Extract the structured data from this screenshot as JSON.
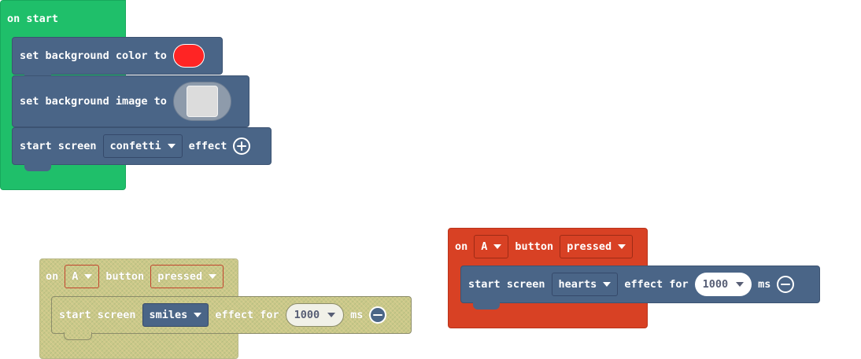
{
  "on_start": {
    "hat_label": "on start",
    "blocks": {
      "bg_color": {
        "label": "set background color to",
        "color_value": "#ff2424"
      },
      "bg_image": {
        "label": "set background image to"
      },
      "effect": {
        "label_pre": "start screen",
        "dropdown": "confetti",
        "label_post": "effect",
        "expand_icon": "plus-circle-icon"
      }
    }
  },
  "event_disabled": {
    "on": "on",
    "button": "A",
    "button_label": "button",
    "state": "pressed",
    "inner": {
      "label_pre": "start screen",
      "effect": "smiles",
      "label_mid": "effect for",
      "duration": "1000",
      "unit": "ms",
      "collapse_icon": "minus-circle-icon"
    }
  },
  "event_active": {
    "on": "on",
    "button": "A",
    "button_label": "button",
    "state": "pressed",
    "inner": {
      "label_pre": "start screen",
      "effect": "hearts",
      "label_mid": "effect for",
      "duration": "1000",
      "unit": "ms",
      "collapse_icon": "minus-circle-icon"
    }
  }
}
